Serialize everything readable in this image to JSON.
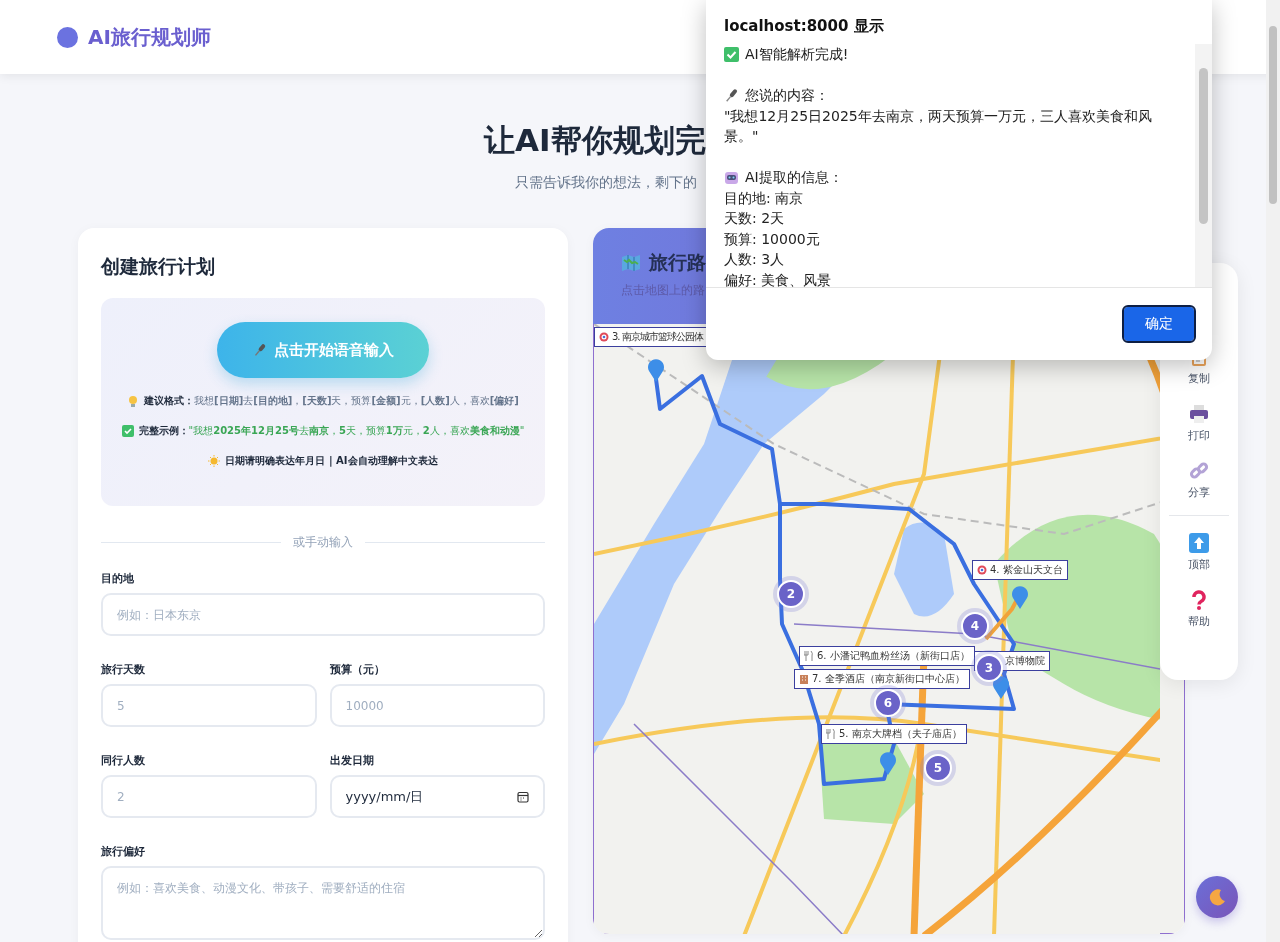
{
  "header": {
    "logo_text": "AI旅行规划师"
  },
  "hero": {
    "title": "让AI帮你规划完",
    "subtitle": "只需告诉我你的想法，剩下的"
  },
  "plan_card": {
    "title": "创建旅行计划",
    "voice_button": "点击开始语音输入",
    "tips": [
      {
        "kind": "format",
        "label": "建议格式：",
        "text": "我想**[日期]**去**[目的地]**，**[天数]**天，预算**[金额]**元，**[人数]**人，喜欢**[偏好]**"
      },
      {
        "kind": "example",
        "label": "完整示例：",
        "text": "\"我想**2025年12月25号**去**南京**，**5**天，预算**1万**元，**2**人，喜欢**美食和动漫**\""
      },
      {
        "kind": "note",
        "text": "日期请明确表达年月日 | AI会自动理解中文表达"
      }
    ],
    "divider_text": "或手动输入",
    "field_rows": [
      [
        {
          "kind": "text",
          "label": "目的地",
          "placeholder": "例如：日本东京"
        }
      ],
      [
        {
          "kind": "text",
          "label": "旅行天数",
          "placeholder": "5"
        },
        {
          "kind": "text",
          "label": "预算（元）",
          "placeholder": "10000"
        }
      ],
      [
        {
          "kind": "text",
          "label": "同行人数",
          "placeholder": "2"
        },
        {
          "kind": "date",
          "label": "出发日期",
          "value": "yyyy/mm/日"
        }
      ],
      [
        {
          "kind": "textarea",
          "label": "旅行偏好",
          "placeholder": "例如：喜欢美食、动漫文化、带孩子、需要舒适的住宿"
        }
      ]
    ]
  },
  "map_card": {
    "title": "旅行路",
    "subtitle": "点击地图上的路",
    "place_labels": [
      {
        "kind": "sight",
        "text": "3. 南京城市篮球公园体"
      },
      {
        "kind": "sight",
        "text": "4. 紫金山天文台"
      },
      {
        "kind": "food",
        "text": "6. 小潘记鸭血粉丝汤（新街口店）"
      },
      {
        "kind": "plain",
        "text": "京博物院"
      },
      {
        "kind": "hotel",
        "text": "7. 全季酒店（南京新街口中心店）"
      },
      {
        "kind": "food",
        "text": "5. 南京大牌档（夫子庙店）"
      }
    ],
    "stops": [
      {
        "label": "2"
      },
      {
        "label": "4"
      },
      {
        "label": "3"
      },
      {
        "label": "6"
      },
      {
        "label": "5"
      }
    ]
  },
  "toolbar": {
    "groups": [
      [
        {
          "kind": "copy",
          "label": "复制"
        },
        {
          "kind": "print",
          "label": "打印"
        },
        {
          "kind": "share",
          "label": "分享"
        }
      ],
      [
        {
          "kind": "top",
          "label": "顶部"
        },
        {
          "kind": "help",
          "label": "帮助"
        }
      ]
    ]
  },
  "dialog": {
    "title": "localhost:8000 显示",
    "sections": [
      {
        "kind": "status",
        "heading": "AI智能解析完成!"
      },
      {
        "kind": "speech",
        "heading": "您说的内容：",
        "body": [
          "\"我想12月25日2025年去南京，两天预算一万元，三人喜欢美食和风景。\""
        ]
      },
      {
        "kind": "extracted",
        "heading": "AI提取的信息：",
        "body": [
          "目的地: 南京",
          "天数: 2天",
          "预算: 10000元",
          "人数: 3人",
          "偏好: 美食、风景"
        ]
      }
    ],
    "ok_button": "确定"
  }
}
